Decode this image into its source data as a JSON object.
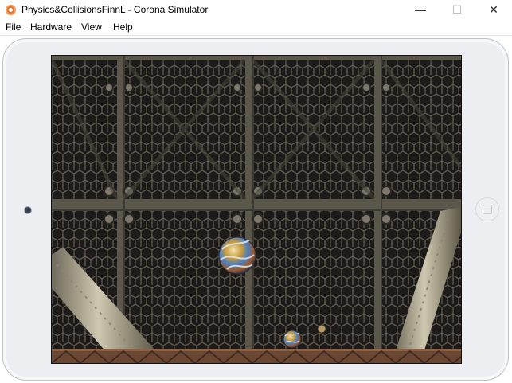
{
  "window": {
    "title": "Physics&CollisionsFinnL - Corona Simulator",
    "controls": {
      "minimize": "—",
      "maximize": "☐",
      "close": "✕"
    }
  },
  "menu": {
    "items": [
      {
        "label": "File"
      },
      {
        "label": "Hardware"
      },
      {
        "label": "View"
      },
      {
        "label": "Help"
      }
    ]
  },
  "device": {
    "type": "tablet",
    "orientation": "landscape"
  },
  "scene": {
    "background": "metal hex mesh grid panels",
    "objects": [
      {
        "name": "large-marble-ball"
      },
      {
        "name": "small-marble-ball"
      },
      {
        "name": "tiny-ball"
      },
      {
        "name": "left-slanted-pipe"
      },
      {
        "name": "right-slanted-pipe"
      },
      {
        "name": "rusty-girder-floor"
      }
    ]
  },
  "colors": {
    "accent": "#e8702a",
    "mesh_bg": "#262422",
    "frame": "#6b6557",
    "girder": "#6a4733"
  }
}
